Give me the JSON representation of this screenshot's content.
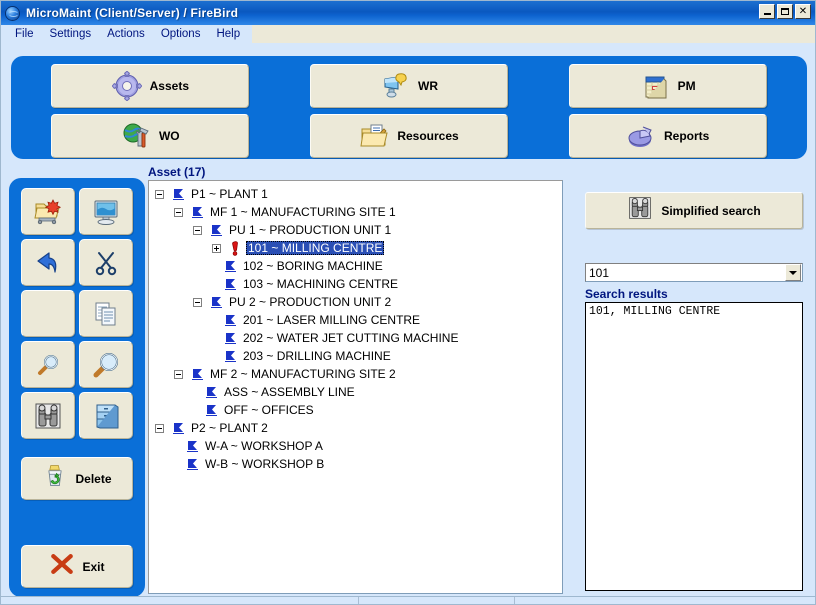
{
  "window": {
    "title": "MicroMaint (Client/Server) / FireBird",
    "icon": "globe-icon",
    "buttons": {
      "minimize": "–",
      "maximize": "□",
      "close": "✕"
    }
  },
  "menubar": {
    "items": [
      {
        "label": "File"
      },
      {
        "label": "Settings"
      },
      {
        "label": "Actions"
      },
      {
        "label": "Options"
      },
      {
        "label": "Help"
      }
    ]
  },
  "toolbar": {
    "rows": [
      [
        {
          "label": "Assets",
          "icon": "gear-icon"
        },
        {
          "label": "WR",
          "icon": "work-request-icon"
        },
        {
          "label": "PM",
          "icon": "calendar-icon"
        }
      ],
      [
        {
          "label": "WO",
          "icon": "globe-tools-icon"
        },
        {
          "label": "Resources",
          "icon": "folder-document-icon"
        },
        {
          "label": "Reports",
          "icon": "pie-chart-icon"
        }
      ]
    ]
  },
  "sidebar": {
    "icon_buttons": [
      {
        "name": "new-record-button",
        "icon": "new-folder-icon"
      },
      {
        "name": "screen-button",
        "icon": "monitor-icon"
      },
      {
        "name": "undo-button",
        "icon": "undo-arrow-icon"
      },
      {
        "name": "cut-button",
        "icon": "scissors-icon"
      },
      {
        "name": "blank-button",
        "icon": "blank-icon"
      },
      {
        "name": "copy-button",
        "icon": "copy-pages-icon"
      },
      {
        "name": "find-button",
        "icon": "magnifier-small-icon"
      },
      {
        "name": "find-next-button",
        "icon": "magnifier-large-icon"
      },
      {
        "name": "advanced-search-button",
        "icon": "binoculars-icon"
      },
      {
        "name": "archive-button",
        "icon": "file-cabinet-icon"
      }
    ],
    "delete": {
      "label": "Delete",
      "icon": "recycle-bin-icon"
    },
    "exit": {
      "label": "Exit",
      "icon": "red-x-icon"
    }
  },
  "main": {
    "asset_label": "Asset (17)",
    "tree": [
      {
        "depth": 0,
        "expander": "minus",
        "icon": "asset-flag-icon",
        "label": "P1 ~ PLANT 1",
        "selected": false
      },
      {
        "depth": 1,
        "expander": "minus",
        "icon": "asset-flag-icon",
        "label": "MF 1 ~ MANUFACTURING SITE 1",
        "selected": false
      },
      {
        "depth": 2,
        "expander": "minus",
        "icon": "asset-flag-icon",
        "label": "PU 1 ~ PRODUCTION UNIT 1",
        "selected": false
      },
      {
        "depth": 3,
        "expander": "plus",
        "icon": "red-exclamation-icon",
        "label": "101 ~ MILLING CENTRE",
        "selected": true
      },
      {
        "depth": 3,
        "expander": "none",
        "icon": "asset-flag-icon",
        "label": "102 ~ BORING MACHINE",
        "selected": false
      },
      {
        "depth": 3,
        "expander": "none",
        "icon": "asset-flag-icon",
        "label": "103 ~ MACHINING CENTRE",
        "selected": false
      },
      {
        "depth": 2,
        "expander": "minus",
        "icon": "asset-flag-icon",
        "label": "PU 2 ~ PRODUCTION UNIT 2",
        "selected": false
      },
      {
        "depth": 3,
        "expander": "none",
        "icon": "asset-flag-icon",
        "label": "201 ~ LASER MILLING CENTRE",
        "selected": false
      },
      {
        "depth": 3,
        "expander": "none",
        "icon": "asset-flag-icon",
        "label": "202 ~ WATER JET CUTTING MACHINE",
        "selected": false
      },
      {
        "depth": 3,
        "expander": "none",
        "icon": "asset-flag-icon",
        "label": "203 ~ DRILLING MACHINE",
        "selected": false
      },
      {
        "depth": 1,
        "expander": "minus",
        "icon": "asset-flag-icon",
        "label": "MF 2 ~ MANUFACTURING SITE 2",
        "selected": false
      },
      {
        "depth": 2,
        "expander": "none",
        "icon": "asset-flag-icon",
        "label": "ASS ~ ASSEMBLY LINE",
        "selected": false
      },
      {
        "depth": 2,
        "expander": "none",
        "icon": "asset-flag-icon",
        "label": "OFF ~ OFFICES",
        "selected": false
      },
      {
        "depth": 0,
        "expander": "minus",
        "icon": "asset-flag-icon",
        "label": "P2 ~ PLANT 2",
        "selected": false
      },
      {
        "depth": 1,
        "expander": "none",
        "icon": "asset-flag-icon",
        "label": "W-A ~ WORKSHOP  A",
        "selected": false
      },
      {
        "depth": 1,
        "expander": "none",
        "icon": "asset-flag-icon",
        "label": "W-B ~ WORKSHOP  B",
        "selected": false
      }
    ]
  },
  "rightpanel": {
    "simplified_search": {
      "label": "Simplified search",
      "icon": "binoculars-icon"
    },
    "combo": {
      "value": "101",
      "placeholder": ""
    },
    "results_label": "Search results",
    "results": [
      "101, MILLING CENTRE"
    ]
  },
  "colors": {
    "panel_blue": "#0a6fd8",
    "window_bg": "#d6e7fb",
    "button_face": "#ece9d8",
    "label_blue": "#00157f",
    "selection_blue": "#2a4fb5",
    "title_gradient_start": "#1c6fd0",
    "title_gradient_end": "#2f87e8"
  }
}
